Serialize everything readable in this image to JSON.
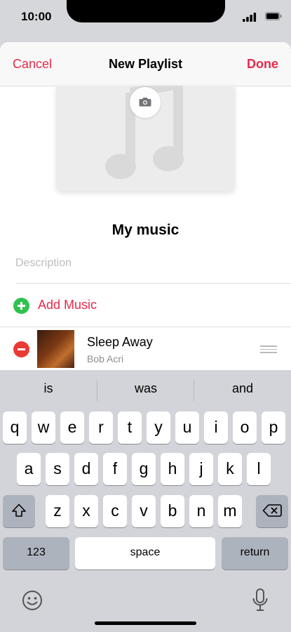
{
  "status": {
    "time": "10:00"
  },
  "nav": {
    "cancel": "Cancel",
    "title": "New Playlist",
    "done": "Done"
  },
  "playlist": {
    "name": "My music",
    "description_placeholder": "Description"
  },
  "add_music": {
    "label": "Add Music"
  },
  "songs": [
    {
      "title": "Sleep Away",
      "artist": "Bob Acri"
    }
  ],
  "keyboard": {
    "suggestions": [
      "is",
      "was",
      "and"
    ],
    "row1": [
      "q",
      "w",
      "e",
      "r",
      "t",
      "y",
      "u",
      "i",
      "o",
      "p"
    ],
    "row2": [
      "a",
      "s",
      "d",
      "f",
      "g",
      "h",
      "j",
      "k",
      "l"
    ],
    "row3": [
      "z",
      "x",
      "c",
      "v",
      "b",
      "n",
      "m"
    ],
    "numbers": "123",
    "space": "space",
    "return": "return"
  },
  "colors": {
    "accent": "#e8294a",
    "add": "#30c24f",
    "remove": "#e93a34"
  }
}
